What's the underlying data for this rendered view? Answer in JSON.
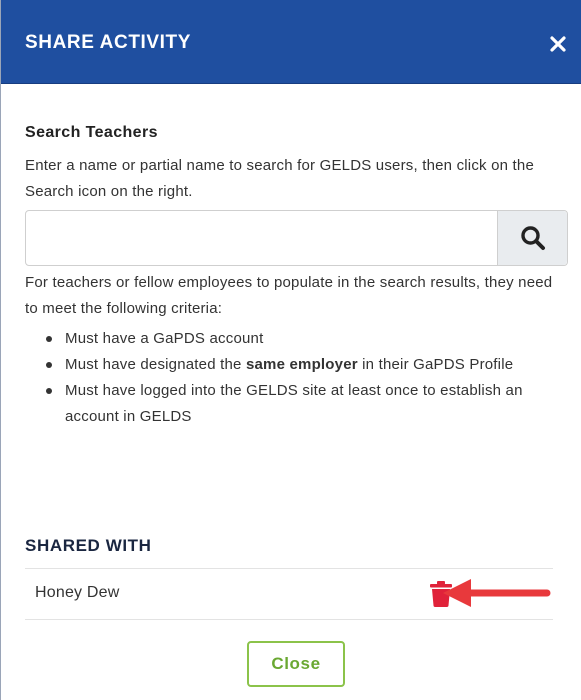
{
  "modal": {
    "title": "SHARE ACTIVITY",
    "close_icon": "close-icon"
  },
  "search": {
    "section_title": "Search Teachers",
    "instructions": "Enter a name or partial name to search for GELDS users, then click on the Search icon on the right.",
    "value": "",
    "placeholder": "",
    "button_icon": "search-icon"
  },
  "criteria": {
    "intro": "For teachers or fellow employees to populate in the search results, they need to meet the following criteria:",
    "items": [
      {
        "text": "Must have a GaPDS account"
      },
      {
        "before": "Must have designated the ",
        "bold": "same employer",
        "after": " in their GaPDS Profile"
      },
      {
        "text": "Must have logged into the GELDS site at least once to establish an account in GELDS"
      }
    ]
  },
  "shared": {
    "section_title": "SHARED WITH",
    "users": [
      {
        "name": "Honey Dew",
        "action_icon": "trash-icon"
      }
    ]
  },
  "footer": {
    "close_label": "Close"
  },
  "colors": {
    "header_bg": "#1f4fa0",
    "trash": "#e0223a",
    "arrow": "#e8393c",
    "close_button": "#8bc34a"
  }
}
